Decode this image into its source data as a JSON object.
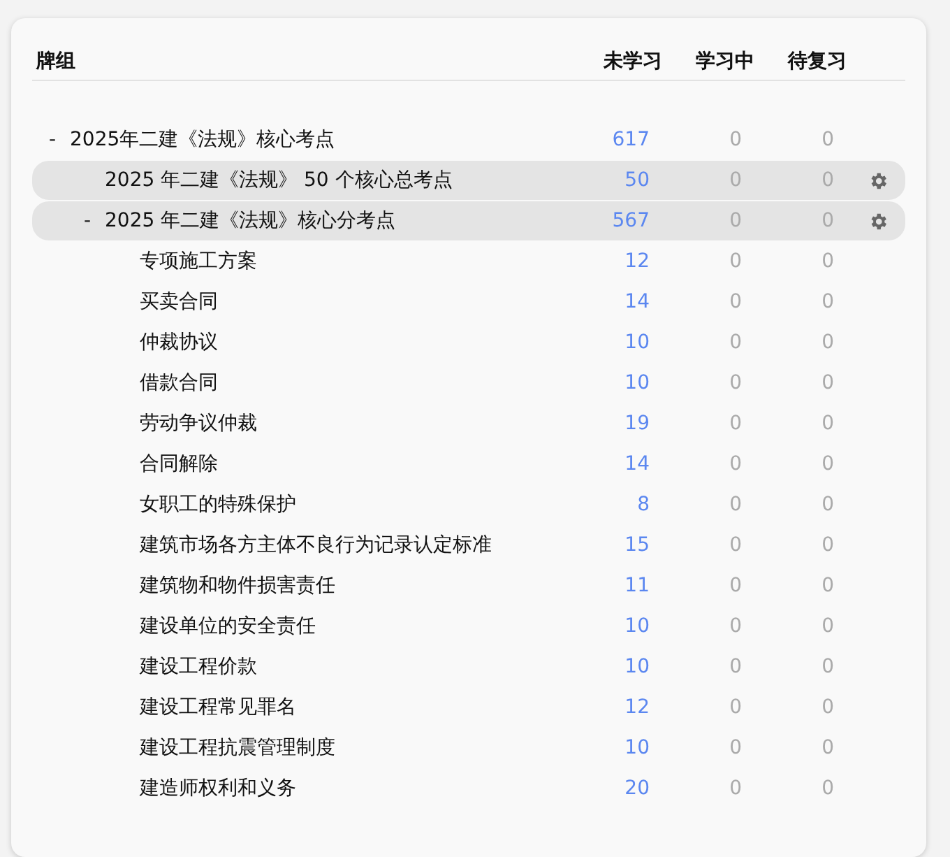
{
  "columns": {
    "deck": "牌组",
    "new": "未学习",
    "learning": "学习中",
    "review": "待复习"
  },
  "decks": [
    {
      "name": "2025年二建《法规》核心考点",
      "expander": "-",
      "selected": false,
      "new": "617",
      "learning": "0",
      "review": "0",
      "children": [
        {
          "name": "2025 年二建《法规》 50 个核心总考点",
          "selected": true,
          "new": "50",
          "learning": "0",
          "review": "0"
        },
        {
          "name": "2025 年二建《法规》核心分考点",
          "expander": "-",
          "selected": true,
          "new": "567",
          "learning": "0",
          "review": "0",
          "children": [
            {
              "name": "专项施工方案",
              "selected": false,
              "new": "12",
              "learning": "0",
              "review": "0"
            },
            {
              "name": "买卖合同",
              "selected": false,
              "new": "14",
              "learning": "0",
              "review": "0"
            },
            {
              "name": "仲裁协议",
              "selected": false,
              "new": "10",
              "learning": "0",
              "review": "0"
            },
            {
              "name": "借款合同",
              "selected": false,
              "new": "10",
              "learning": "0",
              "review": "0"
            },
            {
              "name": "劳动争议仲裁",
              "selected": false,
              "new": "19",
              "learning": "0",
              "review": "0"
            },
            {
              "name": "合同解除",
              "selected": false,
              "new": "14",
              "learning": "0",
              "review": "0"
            },
            {
              "name": "女职工的特殊保护",
              "selected": false,
              "new": "8",
              "learning": "0",
              "review": "0"
            },
            {
              "name": "建筑市场各方主体不良行为记录认定标准",
              "selected": false,
              "new": "15",
              "learning": "0",
              "review": "0"
            },
            {
              "name": "建筑物和物件损害责任",
              "selected": false,
              "new": "11",
              "learning": "0",
              "review": "0"
            },
            {
              "name": "建设单位的安全责任",
              "selected": false,
              "new": "10",
              "learning": "0",
              "review": "0"
            },
            {
              "name": "建设工程价款",
              "selected": false,
              "new": "10",
              "learning": "0",
              "review": "0"
            },
            {
              "name": "建设工程常见罪名",
              "selected": false,
              "new": "12",
              "learning": "0",
              "review": "0"
            },
            {
              "name": "建设工程抗震管理制度",
              "selected": false,
              "new": "10",
              "learning": "0",
              "review": "0"
            },
            {
              "name": "建造师权利和义务",
              "selected": false,
              "new": "20",
              "learning": "0",
              "review": "0"
            }
          ]
        }
      ]
    }
  ]
}
